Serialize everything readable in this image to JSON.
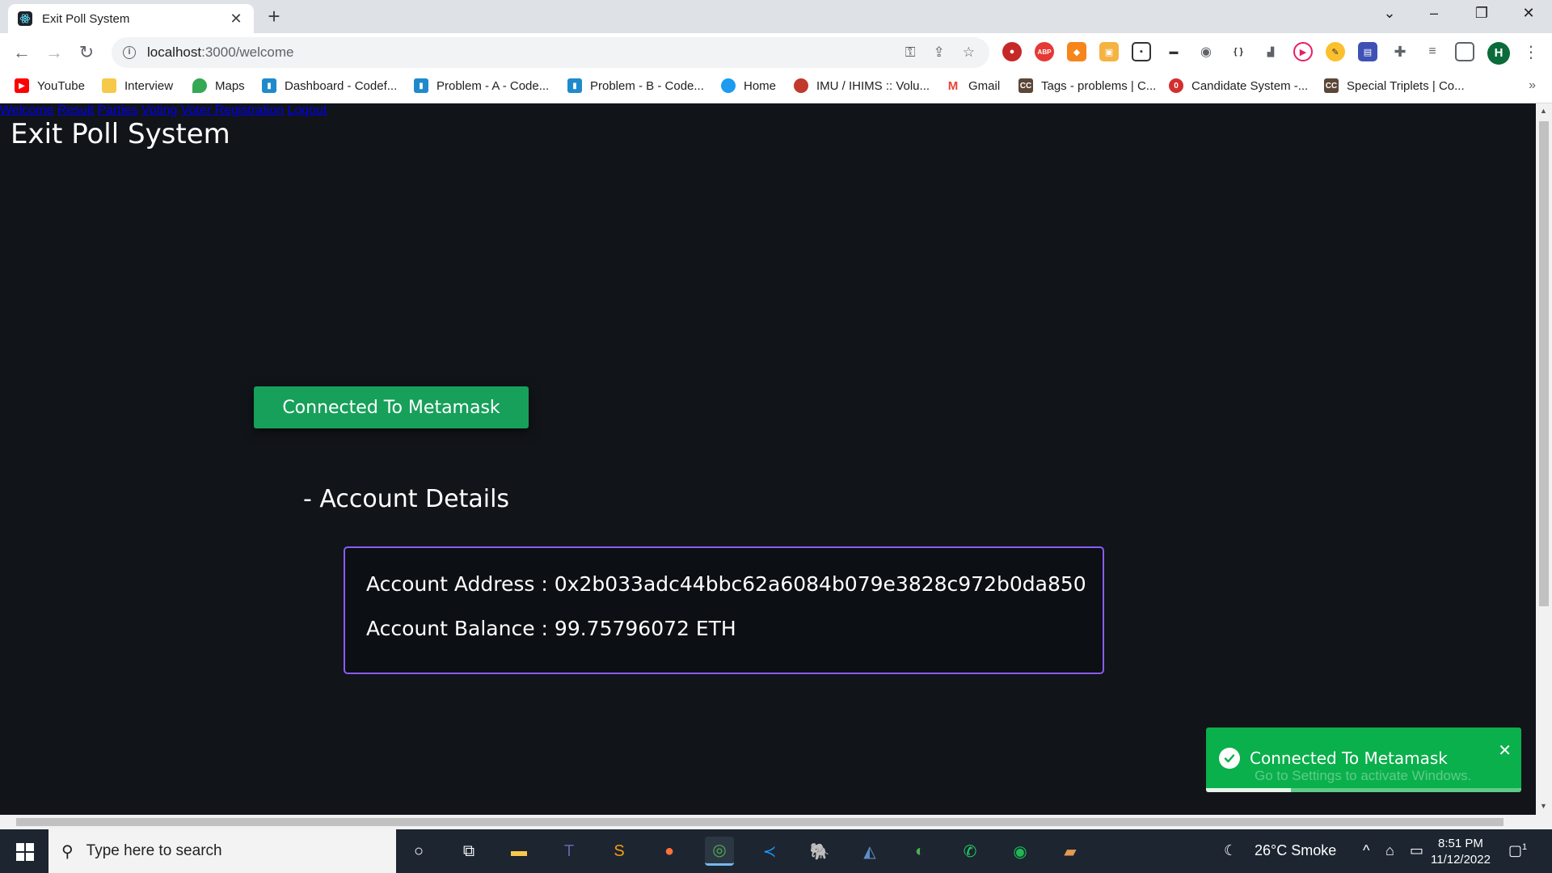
{
  "browser": {
    "tab_title": "Exit Poll System",
    "tab_close": "✕",
    "new_tab": "+",
    "url_host": "localhost",
    "url_path": ":3000/welcome",
    "profile_initial": "H",
    "bookmarks": [
      {
        "label": "YouTube",
        "icon": "youtube-icon",
        "color": "#ff0000"
      },
      {
        "label": "Interview",
        "icon": "folder-icon",
        "color": "#f6c94a"
      },
      {
        "label": "Maps",
        "icon": "maps-icon",
        "color": "#34a853"
      },
      {
        "label": "Dashboard - Codef...",
        "icon": "codeforces-icon",
        "color": "#1f8acb"
      },
      {
        "label": "Problem - A - Code...",
        "icon": "codeforces-icon",
        "color": "#1f8acb"
      },
      {
        "label": "Problem - B - Code...",
        "icon": "codeforces-icon",
        "color": "#1f8acb"
      },
      {
        "label": "Home",
        "icon": "twitter-icon",
        "color": "#1d9bf0"
      },
      {
        "label": "IMU / IHIMS :: Volu...",
        "icon": "imu-icon",
        "color": "#c0392b"
      },
      {
        "label": "Gmail",
        "icon": "gmail-icon",
        "color": "#ea4335"
      },
      {
        "label": "Tags - problems | C...",
        "icon": "codechef-icon",
        "color": "#5b4638"
      },
      {
        "label": "Candidate System -...",
        "icon": "candidate-icon",
        "color": "#d32f2f"
      },
      {
        "label": "Special Triplets | Co...",
        "icon": "codechef-icon",
        "color": "#5b4638"
      }
    ],
    "bookmarks_more": "»"
  },
  "app": {
    "brand": "Exit Poll System",
    "nav": [
      "Welcome",
      "Result",
      "Parties",
      "Voting",
      "Voter Registration",
      "Logout"
    ],
    "connect_button": "Connected To Metamask",
    "account_heading": "- Account Details",
    "account_address_label": "Account Address : 0x2b033adc44bbc62a6084b079e3828c972b0da850",
    "account_balance_label": "Account Balance : 99.75796072 ETH"
  },
  "toast": {
    "message": "Connected To Metamask",
    "close": "✕",
    "progress": 0.27,
    "watermark": "Go to Settings to activate Windows."
  },
  "taskbar": {
    "search_placeholder": "Type here to search",
    "weather": "26°C  Smoke",
    "time": "8:51 PM",
    "date": "11/12/2022",
    "notification_count": "1"
  },
  "colors": {
    "accent_green": "#17a05a",
    "toast_green": "#0ab04b",
    "box_border": "#8b5cf6",
    "page_bg": "#111419"
  }
}
